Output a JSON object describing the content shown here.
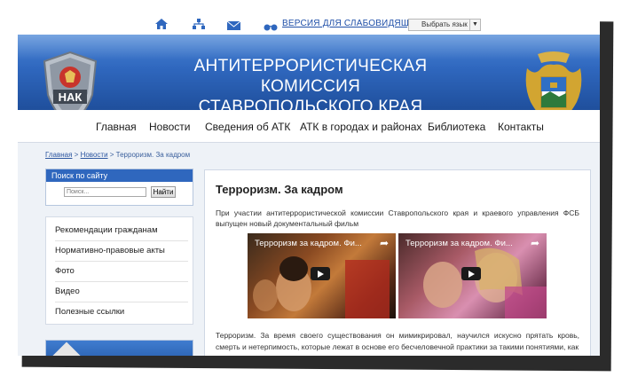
{
  "topbar": {
    "icons": [
      "home-icon",
      "sitemap-icon",
      "mail-icon",
      "glasses-icon"
    ],
    "vision_link": "ВЕРСИЯ ДЛЯ СЛАБОВИДЯЩИХ",
    "language_select": "Выбрать язык",
    "language_arrow": "▼"
  },
  "header": {
    "title_line1": "АНТИТЕРРОРИСТИЧЕСКАЯ КОМИССИЯ",
    "title_line2": "СТАВРОПОЛЬСКОГО КРАЯ",
    "logo_text": "НАК"
  },
  "nav": {
    "items": [
      "Главная",
      "Новости",
      "Сведения об АТК",
      "АТК в городах и районах",
      "Библиотека",
      "Контакты"
    ]
  },
  "breadcrumb": {
    "home": "Главная",
    "sep1": " > ",
    "news": "Новости",
    "sep2": " > ",
    "current": "Терроризм. За кадром"
  },
  "search": {
    "title": "Поиск по сайту",
    "placeholder": "Поиск...",
    "button": "Найти"
  },
  "sidebar": {
    "items": [
      "Рекомендации гражданам",
      "Нормативно-правовые акты",
      "Фото",
      "Видео",
      "Полезные ссылки"
    ]
  },
  "article": {
    "title": "Терроризм. За кадром",
    "intro": "При участии антитеррористической комиссии Ставропольского края и краевого управления ФСБ выпущен новый документальный фильм",
    "videos": [
      {
        "title": "Терроризм за кадром. Фи..."
      },
      {
        "title": "Терроризм за кадром. Фи..."
      }
    ],
    "body": "Терроризм. За время своего существования он мимикрировал, научился искусно прятать кровь, смерть и нетерпимость, которые лежат в основе его бесчеловечной практики за такими понятиями, как"
  },
  "colors": {
    "banner": "#2f67be",
    "link": "#1f4fa8",
    "content_bg": "#eef2f7"
  }
}
